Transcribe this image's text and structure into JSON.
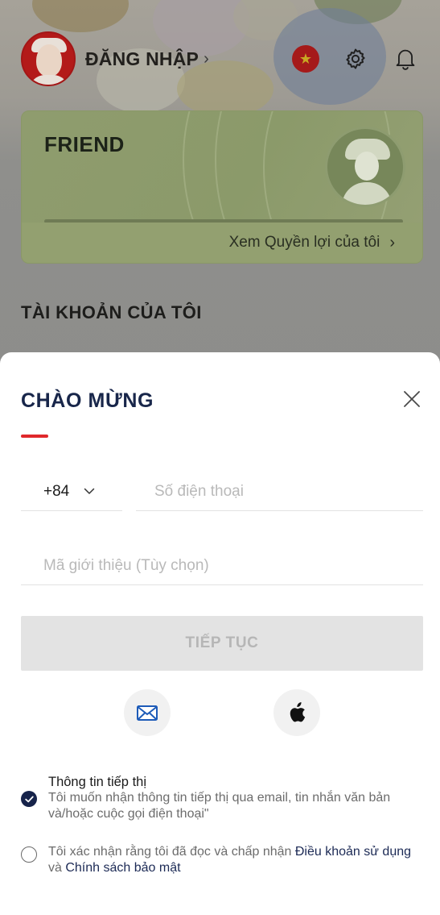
{
  "header": {
    "login_label": "ĐĂNG NHẬP",
    "login_chevron": "›",
    "flag_star": "★"
  },
  "tier_card": {
    "tier_name": "FRIEND",
    "benefits_link": "Xem Quyền lợi của tôi",
    "benefits_chevron": "›"
  },
  "account_section": {
    "title": "TÀI KHOẢN CỦA TÔI"
  },
  "login_sheet": {
    "title": "CHÀO MỪNG",
    "country_code": "+84",
    "phone_placeholder": "Số điện thoại",
    "referral_placeholder": "Mã giới thiệu (Tùy chọn)",
    "continue_label": "TIẾP TỤC",
    "marketing_consent": {
      "checked": true,
      "heading": "Thông tin tiếp thị",
      "body": "Tôi muốn nhận thông tin tiếp thị qua email, tin nhắn văn bản và/hoặc cuộc gọi điện thoại\""
    },
    "terms_consent": {
      "checked": false,
      "text_before": "Tôi xác nhận rằng tôi đã đọc và chấp nhận ",
      "terms_link": "Điều khoản sử dụng",
      "text_middle": " và ",
      "privacy_link": "Chính sách bảo mật"
    }
  },
  "icons": {
    "settings": "gear-icon",
    "notifications": "bell-icon",
    "close": "close-icon",
    "country_chevron": "chevron-down-icon",
    "email": "envelope-icon",
    "apple": "apple-icon",
    "check": "checkmark-icon"
  },
  "colors": {
    "brand_navy": "#18264a",
    "brand_red": "#e0282b",
    "tier_green": "#8f9c6e",
    "disabled_button": "#e3e3e3",
    "email_icon_blue": "#1d5bb8"
  }
}
